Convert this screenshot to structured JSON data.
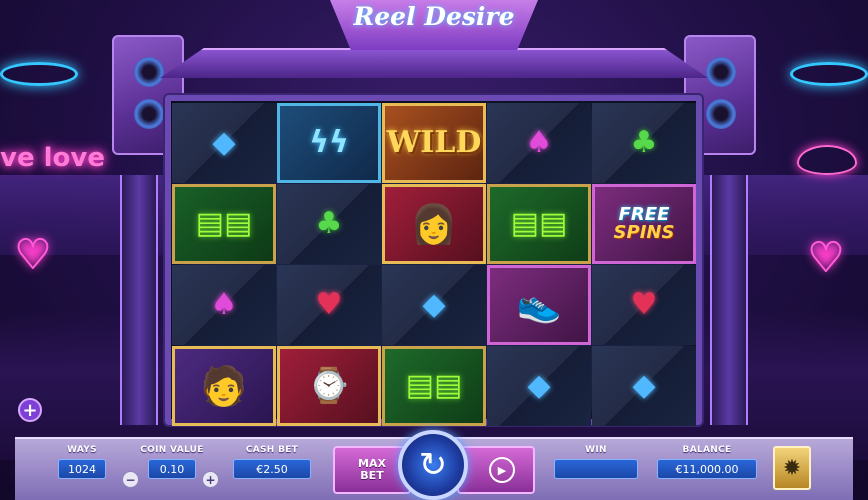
{
  "game": {
    "logo_text": "Reel Desire",
    "logo_icon": "neon-logo"
  },
  "background": {
    "sign_text": "ve love",
    "decor_icons": [
      "heart-arrow-icon",
      "double-heart-icon",
      "lips-icon"
    ]
  },
  "side_button": {
    "label": "+",
    "icon": "plus-circle-icon"
  },
  "reels": {
    "columns": 5,
    "rows": 4,
    "cells": [
      [
        "diamond",
        "earrings",
        "wild",
        "spade",
        "club"
      ],
      [
        "glasses",
        "club",
        "woman",
        "glasses",
        "free_spins"
      ],
      [
        "spade",
        "heart",
        "diamond",
        "sneakers",
        "heart"
      ],
      [
        "man",
        "watch",
        "glasses",
        "diamond",
        "diamond"
      ]
    ],
    "wild_label": "WILD",
    "free_label": "FREE",
    "spins_label": "SPINS"
  },
  "controls": {
    "ways": {
      "label": "WAYS",
      "value": "1024"
    },
    "coin_value": {
      "label": "COIN VALUE",
      "value": "0.10",
      "minus": "−",
      "plus": "+"
    },
    "cash_bet": {
      "label": "CASH BET",
      "value": "€2.50"
    },
    "max_bet": {
      "line1": "MAX",
      "line2": "BET"
    },
    "spin": {
      "icon": "spin-arrow-icon",
      "glyph": "↻"
    },
    "autoplay": {
      "icon": "autoplay-icon",
      "glyph": "▶"
    },
    "win": {
      "label": "WIN",
      "value": ""
    },
    "balance": {
      "label": "BALANCE",
      "value": "€11,000.00"
    },
    "menu": {
      "icon": "menu-logo-icon",
      "glyph": "✹"
    }
  },
  "colors": {
    "neon_blue": "#35c7ff",
    "neon_pink": "#ff3ecb",
    "value_box": "#2a66d8"
  }
}
